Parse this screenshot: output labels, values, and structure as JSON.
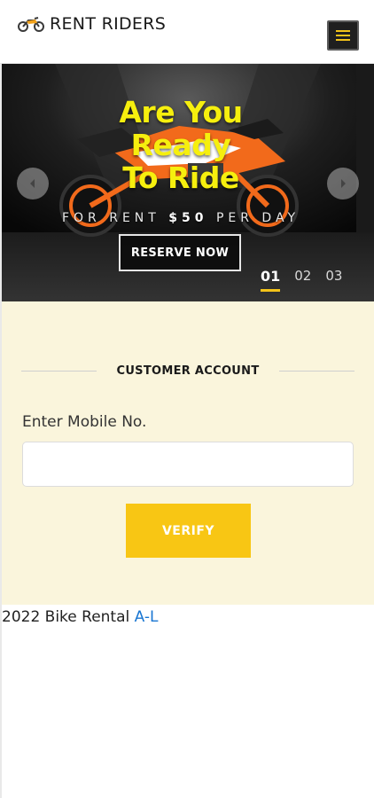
{
  "header": {
    "brand_name": "RENT RIDERS",
    "brand_icon": "motorbike-icon",
    "menu_icon": "hamburger-menu-icon",
    "colors": {
      "menu_bg": "#1f1f1f",
      "menu_lines": "#f3c31a"
    }
  },
  "hero": {
    "title_line_1": "Are You",
    "title_line_2": "Ready",
    "title_line_3": "To Ride",
    "subtitle_pre": "FOR RENT ",
    "subtitle_price": "$50",
    "subtitle_post": " PER DAY",
    "reserve_label": "RESERVE NOW",
    "prev_icon": "chevron-left-icon",
    "next_icon": "chevron-right-icon",
    "slides": [
      "01",
      "02",
      "03"
    ],
    "active_slide": "01",
    "colors": {
      "title": "#f6ef0e",
      "indicator": "#f3c31a",
      "bike_body": "#f26a1b"
    }
  },
  "account": {
    "section_title": "CUSTOMER ACCOUNT",
    "mobile_label": "Enter Mobile No.",
    "mobile_value": "",
    "verify_label": "VERIFY",
    "colors": {
      "section_bg": "#faf5dc",
      "button": "#f8c614"
    }
  },
  "footer": {
    "text": "2022 Bike Rental ",
    "link": "A-L",
    "colors": {
      "link": "#1976d2"
    }
  }
}
